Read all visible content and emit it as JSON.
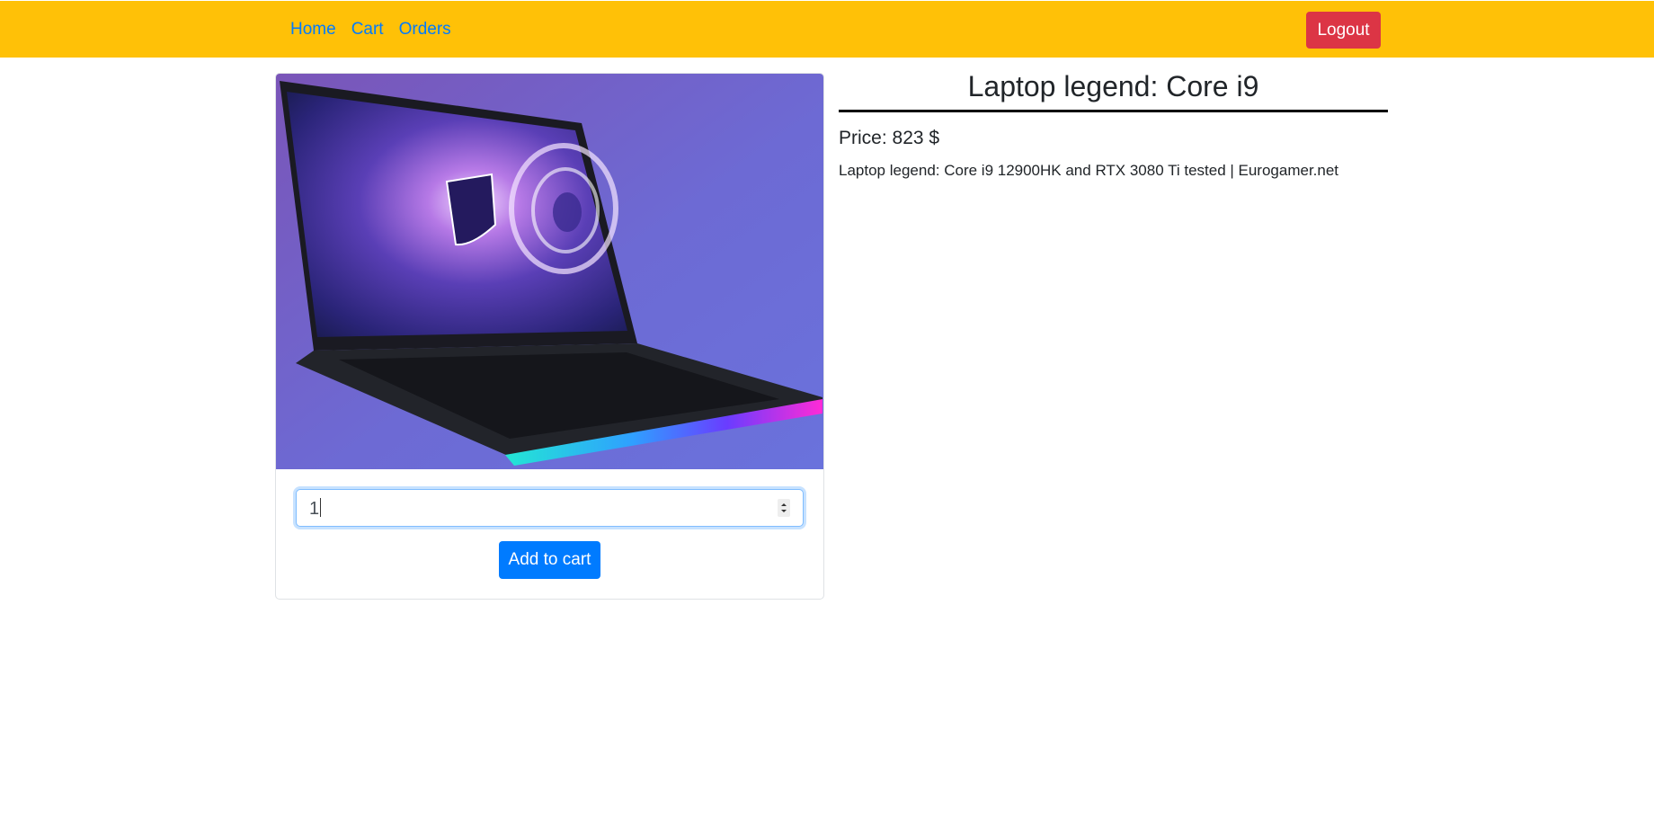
{
  "nav": {
    "links": [
      "Home",
      "Cart",
      "Orders"
    ],
    "logout_label": "Logout"
  },
  "product": {
    "title": "Laptop legend: Core i9",
    "price_text": "Price: 823 $",
    "description": "Laptop legend: Core i9 12900HK and RTX 3080 Ti tested | Eurogamer.net",
    "quantity": "1",
    "add_to_cart_label": "Add to cart"
  },
  "colors": {
    "navbar": "#ffc107",
    "link": "#007bff",
    "logout": "#dc3545",
    "primary": "#007bff"
  }
}
